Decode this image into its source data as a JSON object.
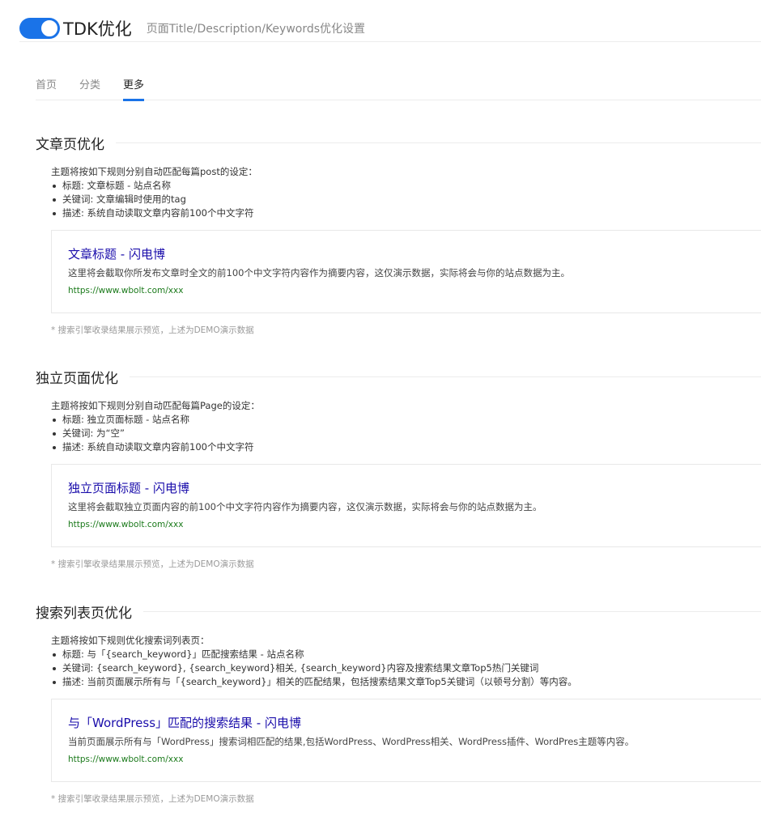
{
  "header": {
    "title": "TDK优化",
    "subtitle": "页面Title/Description/Keywords优化设置"
  },
  "tabs": [
    {
      "label": "首页"
    },
    {
      "label": "分类"
    },
    {
      "label": "更多"
    }
  ],
  "sections": [
    {
      "title": "文章页优化",
      "intro": "主题将按如下规则分别自动匹配每篇post的设定：",
      "rules": [
        "标题: 文章标题 - 站点名称",
        "关键词: 文章编辑时使用的tag",
        "描述: 系统自动读取文章内容前100个中文字符"
      ],
      "preview": {
        "title": "文章标题 - 闪电博",
        "desc": "这里将会截取你所发布文章时全文的前100个中文字符内容作为摘要内容，这仅演示数据，实际将会与你的站点数据为主。",
        "url": "https://www.wbolt.com/xxx"
      },
      "note": "* 搜索引擎收录结果展示预览，上述为DEMO演示数据"
    },
    {
      "title": "独立页面优化",
      "intro": "主题将按如下规则分别自动匹配每篇Page的设定：",
      "rules": [
        "标题: 独立页面标题 - 站点名称",
        "关键词: 为“空”",
        "描述: 系统自动读取文章内容前100个中文字符"
      ],
      "preview": {
        "title": "独立页面标题 - 闪电博",
        "desc": "这里将会截取独立页面内容的前100个中文字符内容作为摘要内容，这仅演示数据，实际将会与你的站点数据为主。",
        "url": "https://www.wbolt.com/xxx"
      },
      "note": "* 搜索引擎收录结果展示预览，上述为DEMO演示数据"
    },
    {
      "title": "搜索列表页优化",
      "intro": "主题将按如下规则优化搜索词列表页：",
      "rules": [
        "标题: 与「{search_keyword}」匹配搜索结果 - 站点名称",
        "关键词: {search_keyword}, {search_keyword}相关, {search_keyword}内容及搜索结果文章Top5热门关键词",
        "描述: 当前页面展示所有与「{search_keyword}」相关的匹配结果，包括搜索结果文章Top5关键词（以顿号分割）等内容。"
      ],
      "preview": {
        "title": "与「WordPress」匹配的搜索结果 - 闪电博",
        "desc": "当前页面展示所有与「WordPress」搜索词相匹配的结果,包括WordPress、WordPress相关、WordPress插件、WordPres主题等内容。",
        "url": "https://www.wbolt.com/xxx"
      },
      "note": "* 搜索引擎收录结果展示预览，上述为DEMO演示数据"
    }
  ],
  "colors": {
    "accent": "#1a73e8",
    "link": "#1a0dab",
    "url": "#1b7a1b"
  }
}
